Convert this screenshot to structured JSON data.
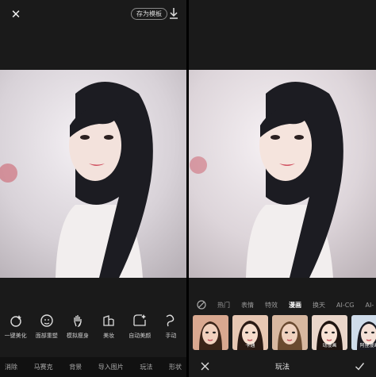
{
  "left": {
    "close_icon": "close-icon",
    "save_template": "存为模板",
    "download_icon": "download-icon",
    "tools": [
      {
        "icon": "beauty-icon",
        "label": "一键美化"
      },
      {
        "icon": "face-reshape-icon",
        "label": "面部重塑"
      },
      {
        "icon": "hand-icon",
        "label": "模拟瘦身"
      },
      {
        "icon": "makeup-icon",
        "label": "美妆"
      },
      {
        "icon": "auto-beauty-icon",
        "label": "自动美颜"
      },
      {
        "icon": "manual-icon",
        "label": "手动"
      }
    ],
    "bottom_nav": [
      "消除",
      "马赛克",
      "背景",
      "导入图片",
      "玩法",
      "形状"
    ]
  },
  "right": {
    "categories": [
      "热门",
      "表情",
      "特效",
      "漫画",
      "换天",
      "AI-CG",
      "AI-"
    ],
    "active_category": "漫画",
    "thumbnails": [
      {
        "label": ""
      },
      {
        "label": "卡通"
      },
      {
        "label": ""
      },
      {
        "label": "动漫画"
      },
      {
        "label": "阿狸漫画"
      },
      {
        "label": ""
      }
    ],
    "footer_title": "玩法"
  },
  "colors": {
    "background": "#1a1a1a",
    "active": "#ffffff",
    "muted": "#999999"
  }
}
